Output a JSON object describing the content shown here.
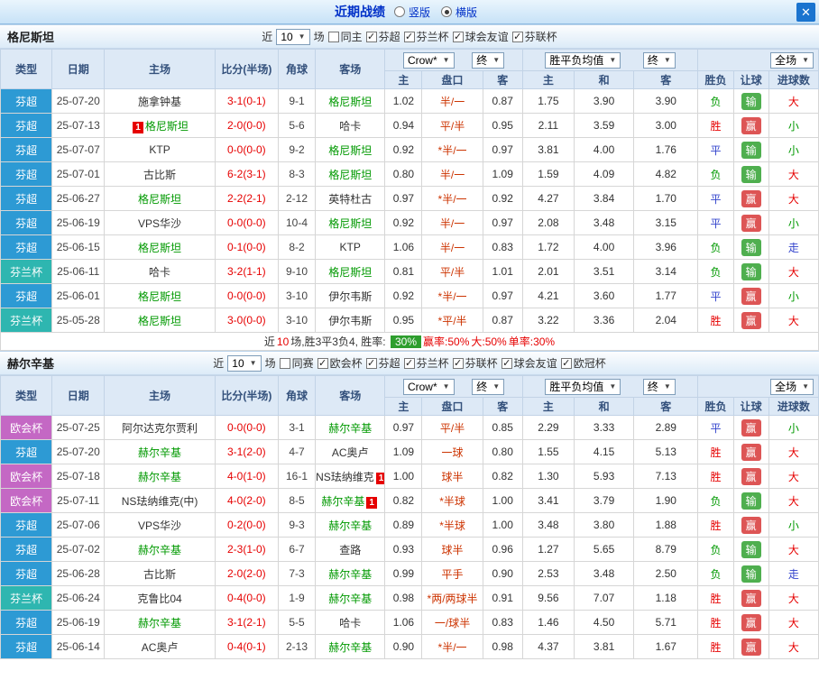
{
  "header": {
    "title": "近期战绩",
    "radio_vertical": "竖版",
    "radio_horizontal": "横版",
    "selected_view": "横版",
    "close_label": "✕"
  },
  "icons": {
    "check": "✓",
    "dropdown_arrow": "▼"
  },
  "filter_labels": {
    "near": "近",
    "games": "场"
  },
  "columns": {
    "main": [
      "类型",
      "日期",
      "主场",
      "比分(半场)",
      "角球",
      "客场"
    ],
    "sub": [
      "主",
      "盘口",
      "客",
      "主",
      "和",
      "客",
      "胜负",
      "让球",
      "进球数"
    ],
    "dropdowns": {
      "bookmaker": "Crow*",
      "final1": "终",
      "avg": "胜平负均值",
      "final2": "终",
      "scope": "全场"
    }
  },
  "colors": {
    "result": {
      "胜": "#e60000",
      "平": "#3344cc",
      "负": "#009900"
    },
    "goals": {
      "大": "#e60000",
      "小": "#009900",
      "走": "#3344cc"
    },
    "handicap_badge": {
      "赢": "#dd5555",
      "输": "#4faf4f"
    },
    "green_team": "#009900",
    "score": "#e60000",
    "handicap": "#cc3300",
    "card": "#e60000",
    "percent_badge": "#2e9e2e"
  },
  "type_colors": {
    "芬超": "#2d9ad4",
    "芬兰杯": "#2eb6b0",
    "欧会杯": "#c468c4"
  },
  "tables": [
    {
      "team": "格尼斯坦",
      "filter_count": "10",
      "filter_checkboxes": [
        {
          "label": "同主",
          "checked": false
        },
        {
          "label": "芬超",
          "checked": true
        },
        {
          "label": "芬兰杯",
          "checked": true
        },
        {
          "label": "球会友谊",
          "checked": true
        },
        {
          "label": "芬联杯",
          "checked": true
        }
      ],
      "rows": [
        {
          "type": "芬超",
          "date": "25-07-20",
          "home": {
            "name": "施拿钟基"
          },
          "score": "3-1(0-1)",
          "corner": "9-1",
          "away": {
            "name": "格尼斯坦",
            "green": true
          },
          "odds": [
            "1.02",
            "半/一",
            "0.87"
          ],
          "avg": [
            "1.75",
            "3.90",
            "3.90"
          ],
          "result": "负",
          "let": "输",
          "goals": "大"
        },
        {
          "type": "芬超",
          "date": "25-07-13",
          "home": {
            "name": "格尼斯坦",
            "green": true,
            "card": "1",
            "card_pos": "left"
          },
          "score": "2-0(0-0)",
          "corner": "5-6",
          "away": {
            "name": "哈卡"
          },
          "odds": [
            "0.94",
            "平/半",
            "0.95"
          ],
          "avg": [
            "2.11",
            "3.59",
            "3.00"
          ],
          "result": "胜",
          "let": "赢",
          "goals": "小"
        },
        {
          "type": "芬超",
          "date": "25-07-07",
          "home": {
            "name": "KTP"
          },
          "score": "0-0(0-0)",
          "corner": "9-2",
          "away": {
            "name": "格尼斯坦",
            "green": true
          },
          "odds": [
            "0.92",
            "*半/一",
            "0.97"
          ],
          "avg": [
            "3.81",
            "4.00",
            "1.76"
          ],
          "result": "平",
          "let": "输",
          "goals": "小"
        },
        {
          "type": "芬超",
          "date": "25-07-01",
          "home": {
            "name": "古比斯"
          },
          "score": "6-2(3-1)",
          "corner": "8-3",
          "away": {
            "name": "格尼斯坦",
            "green": true
          },
          "odds": [
            "0.80",
            "半/一",
            "1.09"
          ],
          "avg": [
            "1.59",
            "4.09",
            "4.82"
          ],
          "result": "负",
          "let": "输",
          "goals": "大"
        },
        {
          "type": "芬超",
          "date": "25-06-27",
          "home": {
            "name": "格尼斯坦",
            "green": true
          },
          "score": "2-2(2-1)",
          "corner": "2-12",
          "away": {
            "name": "英特杜古"
          },
          "odds": [
            "0.97",
            "*半/一",
            "0.92"
          ],
          "avg": [
            "4.27",
            "3.84",
            "1.70"
          ],
          "result": "平",
          "let": "赢",
          "goals": "大"
        },
        {
          "type": "芬超",
          "date": "25-06-19",
          "home": {
            "name": "VPS华沙"
          },
          "score": "0-0(0-0)",
          "corner": "10-4",
          "away": {
            "name": "格尼斯坦",
            "green": true
          },
          "odds": [
            "0.92",
            "半/一",
            "0.97"
          ],
          "avg": [
            "2.08",
            "3.48",
            "3.15"
          ],
          "result": "平",
          "let": "赢",
          "goals": "小"
        },
        {
          "type": "芬超",
          "date": "25-06-15",
          "home": {
            "name": "格尼斯坦",
            "green": true
          },
          "score": "0-1(0-0)",
          "corner": "8-2",
          "away": {
            "name": "KTP"
          },
          "odds": [
            "1.06",
            "半/一",
            "0.83"
          ],
          "avg": [
            "1.72",
            "4.00",
            "3.96"
          ],
          "result": "负",
          "let": "输",
          "goals": "走"
        },
        {
          "type": "芬兰杯",
          "date": "25-06-11",
          "home": {
            "name": "哈卡"
          },
          "score": "3-2(1-1)",
          "corner": "9-10",
          "away": {
            "name": "格尼斯坦",
            "green": true
          },
          "odds": [
            "0.81",
            "平/半",
            "1.01"
          ],
          "avg": [
            "2.01",
            "3.51",
            "3.14"
          ],
          "result": "负",
          "let": "输",
          "goals": "大"
        },
        {
          "type": "芬超",
          "date": "25-06-01",
          "home": {
            "name": "格尼斯坦",
            "green": true
          },
          "score": "0-0(0-0)",
          "corner": "3-10",
          "away": {
            "name": "伊尔韦斯"
          },
          "odds": [
            "0.92",
            "*半/一",
            "0.97"
          ],
          "avg": [
            "4.21",
            "3.60",
            "1.77"
          ],
          "result": "平",
          "let": "赢",
          "goals": "小"
        },
        {
          "type": "芬兰杯",
          "date": "25-05-28",
          "home": {
            "name": "格尼斯坦",
            "green": true
          },
          "score": "3-0(0-0)",
          "corner": "3-10",
          "away": {
            "name": "伊尔韦斯"
          },
          "odds": [
            "0.95",
            "*平/半",
            "0.87"
          ],
          "avg": [
            "3.22",
            "3.36",
            "2.04"
          ],
          "result": "胜",
          "let": "赢",
          "goals": "大"
        }
      ],
      "summary": [
        {
          "text": "近",
          "color": "#333333"
        },
        {
          "text": "10",
          "color": "#e60000"
        },
        {
          "text": "场,胜3平3负4, 胜率: ",
          "color": "#333333"
        },
        {
          "text": "30%",
          "color": "#ffffff",
          "bg": "#2e9e2e"
        },
        {
          "text": "赢率:50%",
          "color": "#e60000"
        },
        {
          "text": "大:50%",
          "color": "#e60000"
        },
        {
          "text": "单率:30%",
          "color": "#e60000"
        }
      ]
    },
    {
      "team": "赫尔辛基",
      "filter_count": "10",
      "filter_checkboxes": [
        {
          "label": "同赛",
          "checked": false
        },
        {
          "label": "欧会杯",
          "checked": true
        },
        {
          "label": "芬超",
          "checked": true
        },
        {
          "label": "芬兰杯",
          "checked": true
        },
        {
          "label": "芬联杯",
          "checked": true
        },
        {
          "label": "球会友谊",
          "checked": true
        },
        {
          "label": "欧冠杯",
          "checked": true
        }
      ],
      "rows": [
        {
          "type": "欧会杯",
          "date": "25-07-25",
          "home": {
            "name": "阿尔达克尔贾利"
          },
          "score": "0-0(0-0)",
          "corner": "3-1",
          "away": {
            "name": "赫尔辛基",
            "green": true
          },
          "odds": [
            "0.97",
            "平/半",
            "0.85"
          ],
          "avg": [
            "2.29",
            "3.33",
            "2.89"
          ],
          "result": "平",
          "let": "赢",
          "goals": "小"
        },
        {
          "type": "芬超",
          "date": "25-07-20",
          "home": {
            "name": "赫尔辛基",
            "green": true
          },
          "score": "3-1(2-0)",
          "corner": "4-7",
          "away": {
            "name": "AC奥卢"
          },
          "odds": [
            "1.09",
            "一球",
            "0.80"
          ],
          "avg": [
            "1.55",
            "4.15",
            "5.13"
          ],
          "result": "胜",
          "let": "赢",
          "goals": "大"
        },
        {
          "type": "欧会杯",
          "date": "25-07-18",
          "home": {
            "name": "赫尔辛基",
            "green": true
          },
          "score": "4-0(1-0)",
          "corner": "16-1",
          "away": {
            "name": "NS珐纳维克",
            "card": "1",
            "card_pos": "right"
          },
          "odds": [
            "1.00",
            "球半",
            "0.82"
          ],
          "avg": [
            "1.30",
            "5.93",
            "7.13"
          ],
          "result": "胜",
          "let": "赢",
          "goals": "大"
        },
        {
          "type": "欧会杯",
          "date": "25-07-11",
          "home": {
            "name": "NS珐纳维克(中)"
          },
          "score": "4-0(2-0)",
          "corner": "8-5",
          "away": {
            "name": "赫尔辛基",
            "green": true,
            "card": "1",
            "card_pos": "right"
          },
          "odds": [
            "0.82",
            "*半球",
            "1.00"
          ],
          "avg": [
            "3.41",
            "3.79",
            "1.90"
          ],
          "result": "负",
          "let": "输",
          "goals": "大"
        },
        {
          "type": "芬超",
          "date": "25-07-06",
          "home": {
            "name": "VPS华沙"
          },
          "score": "0-2(0-0)",
          "corner": "9-3",
          "away": {
            "name": "赫尔辛基",
            "green": true
          },
          "odds": [
            "0.89",
            "*半球",
            "1.00"
          ],
          "avg": [
            "3.48",
            "3.80",
            "1.88"
          ],
          "result": "胜",
          "let": "赢",
          "goals": "小"
        },
        {
          "type": "芬超",
          "date": "25-07-02",
          "home": {
            "name": "赫尔辛基",
            "green": true
          },
          "score": "2-3(1-0)",
          "corner": "6-7",
          "away": {
            "name": "查路"
          },
          "odds": [
            "0.93",
            "球半",
            "0.96"
          ],
          "avg": [
            "1.27",
            "5.65",
            "8.79"
          ],
          "result": "负",
          "let": "输",
          "goals": "大"
        },
        {
          "type": "芬超",
          "date": "25-06-28",
          "home": {
            "name": "古比斯"
          },
          "score": "2-0(2-0)",
          "corner": "7-3",
          "away": {
            "name": "赫尔辛基",
            "green": true
          },
          "odds": [
            "0.99",
            "平手",
            "0.90"
          ],
          "avg": [
            "2.53",
            "3.48",
            "2.50"
          ],
          "result": "负",
          "let": "输",
          "goals": "走"
        },
        {
          "type": "芬兰杯",
          "date": "25-06-24",
          "home": {
            "name": "克鲁比04"
          },
          "score": "0-4(0-0)",
          "corner": "1-9",
          "away": {
            "name": "赫尔辛基",
            "green": true
          },
          "odds": [
            "0.98",
            "*两/两球半",
            "0.91"
          ],
          "avg": [
            "9.56",
            "7.07",
            "1.18"
          ],
          "result": "胜",
          "let": "赢",
          "goals": "大"
        },
        {
          "type": "芬超",
          "date": "25-06-19",
          "home": {
            "name": "赫尔辛基",
            "green": true
          },
          "score": "3-1(2-1)",
          "corner": "5-5",
          "away": {
            "name": "哈卡"
          },
          "odds": [
            "1.06",
            "一/球半",
            "0.83"
          ],
          "avg": [
            "1.46",
            "4.50",
            "5.71"
          ],
          "result": "胜",
          "let": "赢",
          "goals": "大"
        },
        {
          "type": "芬超",
          "date": "25-06-14",
          "home": {
            "name": "AC奥卢"
          },
          "score": "0-4(0-1)",
          "corner": "2-13",
          "away": {
            "name": "赫尔辛基",
            "green": true
          },
          "odds": [
            "0.90",
            "*半/一",
            "0.98"
          ],
          "avg": [
            "4.37",
            "3.81",
            "1.67"
          ],
          "result": "胜",
          "let": "赢",
          "goals": "大"
        }
      ],
      "summary": null
    }
  ]
}
